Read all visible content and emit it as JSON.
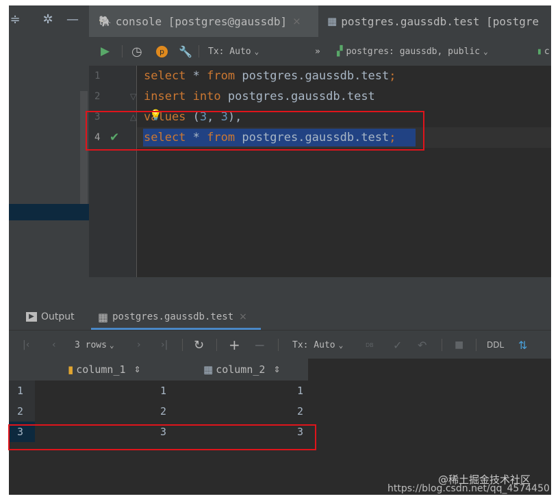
{
  "tabs": {
    "console": "console [postgres@gaussdb]",
    "table": "postgres.gaussdb.test [postgre"
  },
  "editor_toolbar": {
    "tx_mode": "Tx: Auto",
    "more": "»",
    "schema": "postgres: gaussdb, public",
    "session": "c"
  },
  "editor": {
    "line_numbers": [
      "1",
      "2",
      "3",
      "4"
    ],
    "lines": [
      [
        {
          "t": "select",
          "c": "kw"
        },
        {
          "t": " * ",
          "c": "id"
        },
        {
          "t": "from",
          "c": "kw"
        },
        {
          "t": " postgres.gaussdb.test",
          "c": "id"
        },
        {
          "t": ";",
          "c": "kw"
        }
      ],
      [
        {
          "t": "insert",
          "c": "kw"
        },
        {
          "t": " ",
          "c": "id"
        },
        {
          "t": "into",
          "c": "kw"
        },
        {
          "t": " postgres.gaussdb.test",
          "c": "id"
        }
      ],
      [
        {
          "t": "values",
          "c": "kw"
        },
        {
          "t": " (",
          "c": "id"
        },
        {
          "t": "3",
          "c": "num"
        },
        {
          "t": ", ",
          "c": "id"
        },
        {
          "t": "3",
          "c": "num"
        },
        {
          "t": "),",
          "c": "id"
        }
      ],
      [
        {
          "t": "select",
          "c": "kw"
        },
        {
          "t": " * ",
          "c": "id"
        },
        {
          "t": "from",
          "c": "kw"
        },
        {
          "t": " postgres.gaussdb.test",
          "c": "id"
        },
        {
          "t": ";",
          "c": "kw"
        }
      ]
    ]
  },
  "lower_tabs": {
    "output": "Output",
    "table": "postgres.gaussdb.test"
  },
  "results_toolbar": {
    "rows": "3 rows",
    "tx_mode": "Tx: Auto",
    "db_label": "DB",
    "ddl": "DDL"
  },
  "grid": {
    "columns": [
      "column_1",
      "column_2"
    ],
    "rows": [
      {
        "num": "1",
        "c1": "1",
        "c2": "1"
      },
      {
        "num": "2",
        "c1": "2",
        "c2": "2"
      },
      {
        "num": "3",
        "c1": "3",
        "c2": "3"
      }
    ]
  },
  "watermark": {
    "community": "@稀土掘金技术社区",
    "url": "https://blog.csdn.net/qq_4574450"
  },
  "colors": {
    "highlight_box": "#e0141b",
    "keyword": "#cc7832",
    "number": "#6897bb",
    "selection": "#214283"
  }
}
